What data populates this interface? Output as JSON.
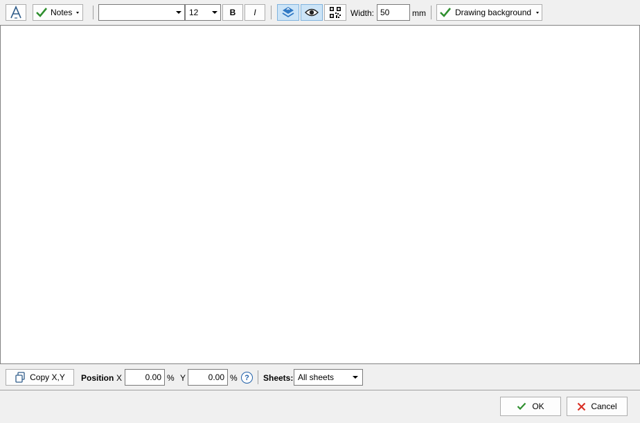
{
  "toolbar": {
    "notes_label": "Notes",
    "font_name": "",
    "font_size": "12",
    "bold_label": "B",
    "italic_label": "I",
    "width_label": "Width:",
    "width_value": "50",
    "width_unit": "mm",
    "background_label": "Drawing background"
  },
  "position_bar": {
    "copy_label": "Copy X,Y",
    "position_label": "Position",
    "x_label": "X",
    "x_value": "0.00",
    "x_unit": "%",
    "y_label": "Y",
    "y_value": "0.00",
    "y_unit": "%",
    "help_glyph": "?",
    "sheets_label": "Sheets:",
    "sheets_value": "All sheets"
  },
  "footer": {
    "ok_label": "OK",
    "cancel_label": "Cancel"
  },
  "colors": {
    "check_green": "#2f8f2f",
    "cancel_red": "#d93025",
    "layer_blue": "#2f78c4",
    "help_blue": "#1f5fa8"
  }
}
